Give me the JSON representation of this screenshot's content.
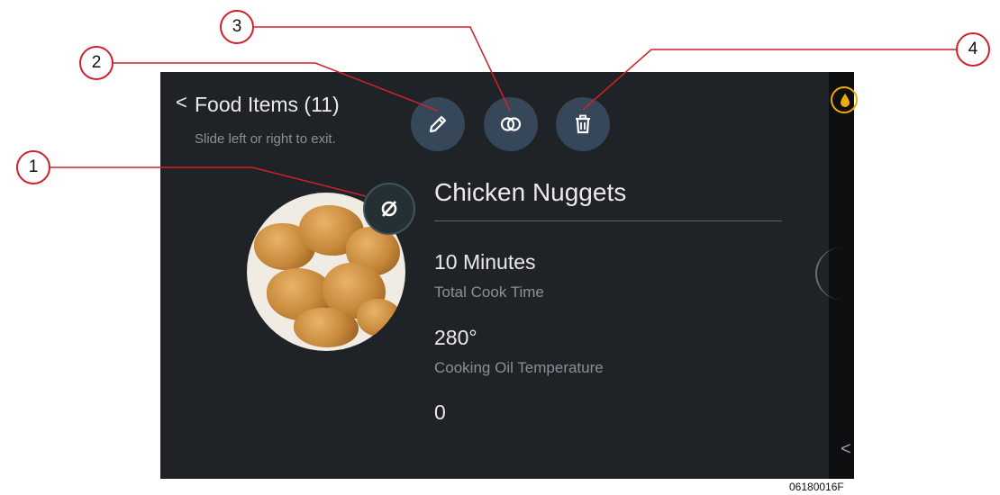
{
  "header": {
    "back_symbol": "<",
    "title": "Food Items (11)",
    "hint": "Slide left or right to exit."
  },
  "toolbar": {
    "edit_icon": "pencil-icon",
    "copy_icon": "overlapping-circles-icon",
    "delete_icon": "trash-icon"
  },
  "item": {
    "name": "Chicken Nuggets",
    "visibility_icon": "eye-slash-icon",
    "photo": "chicken-nuggets",
    "details": [
      {
        "value": "10 Minutes",
        "label": "Total Cook Time"
      },
      {
        "value": "280°",
        "label": "Cooking Oil Temperature"
      },
      {
        "value": "0",
        "label": ""
      }
    ]
  },
  "side_panel": {
    "badge_icon": "oil-drop-icon",
    "chevron": "<"
  },
  "callouts": [
    "1",
    "2",
    "3",
    "4"
  ],
  "figure_code": "06180016F",
  "colors": {
    "screen_bg": "#1f2327",
    "button_bg": "#36475a",
    "callout_red": "#d0202a",
    "badge_accent": "#f2a900"
  }
}
